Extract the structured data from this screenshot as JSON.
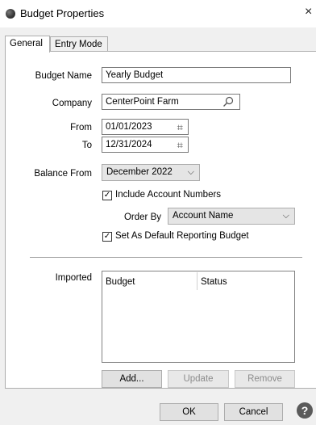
{
  "window": {
    "title": "Budget Properties",
    "close_glyph": "×"
  },
  "tabs": [
    {
      "label": "General",
      "active": true
    },
    {
      "label": "Entry Mode",
      "active": false
    }
  ],
  "form": {
    "budget_name": {
      "label": "Budget Name",
      "value": "Yearly Budget"
    },
    "company": {
      "label": "Company",
      "value": "CenterPoint Farm",
      "icon": "search-icon"
    },
    "from": {
      "label": "From",
      "value": "01/01/2023",
      "icon": "calendar-icon"
    },
    "to": {
      "label": "To",
      "value": "12/31/2024",
      "icon": "calendar-icon"
    },
    "balance_from": {
      "label": "Balance From",
      "value": "December 2022"
    },
    "include_account_numbers": {
      "label": "Include Account Numbers",
      "checked": true
    },
    "order_by": {
      "label": "Order By",
      "value": "Account Name"
    },
    "default_budget": {
      "label": "Set As Default Reporting Budget",
      "checked": true
    }
  },
  "imported": {
    "label": "Imported",
    "columns": [
      "Budget",
      "Status"
    ],
    "rows": []
  },
  "buttons": {
    "add": "Add...",
    "update": "Update",
    "remove": "Remove",
    "ok": "OK",
    "cancel": "Cancel",
    "help": "?"
  },
  "icons": {
    "check": "✓",
    "chevron": "⌵",
    "calendar": "⌗"
  }
}
